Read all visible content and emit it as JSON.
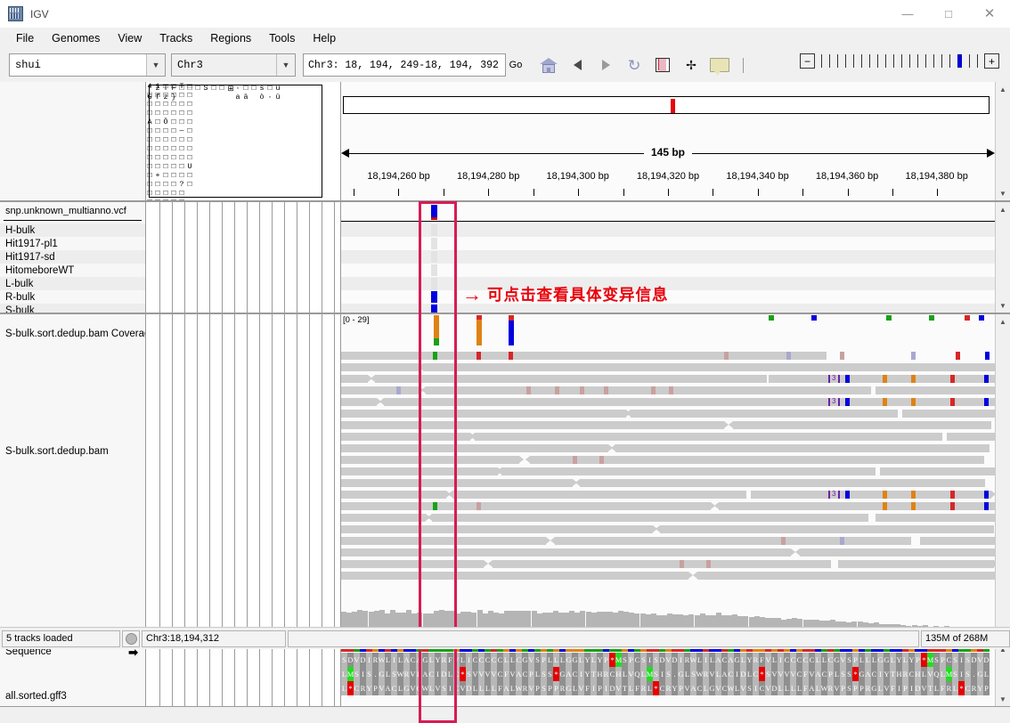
{
  "window": {
    "title": "IGV",
    "logo_icon": "igv-logo-icon",
    "minimize": "—",
    "maximize": "□",
    "close": "✕"
  },
  "menu": {
    "items": [
      "File",
      "Genomes",
      "View",
      "Tracks",
      "Regions",
      "Tools",
      "Help"
    ]
  },
  "toolbar": {
    "genome_value": "shui",
    "genome_placeholder": "Genome",
    "chromosome_value": "Chr3",
    "locus_value": "Chr3: 18, 194, 249-18, 194, 392",
    "go_label": "Go",
    "home_icon": "home-icon",
    "back_icon": "back-arrow-icon",
    "forward_icon": "forward-arrow-icon",
    "refresh_icon": "refresh-icon",
    "region_icon": "region-navigator-icon",
    "fit_icon": "fit-to-window-icon",
    "popup_icon": "popup-behavior-icon",
    "zoom_out_label": "−",
    "zoom_in_label": "+",
    "zoom_ticks": 20,
    "zoom_current_tick": 17
  },
  "ruler": {
    "ideogram_label_column": "4□□□A□□□□□□+□□□□",
    "span_label": "145 bp",
    "ticks": [
      {
        "label": "18,194,260 bp",
        "pos_pct": 8.8
      },
      {
        "label": "18,194,280 bp",
        "pos_pct": 22.5
      },
      {
        "label": "18,194,300 bp",
        "pos_pct": 36.2
      },
      {
        "label": "18,194,320 bp",
        "pos_pct": 50.0
      },
      {
        "label": "18,194,340 bp",
        "pos_pct": 63.7
      },
      {
        "label": "18,194,360 bp",
        "pos_pct": 77.4
      },
      {
        "label": "18,194,380 bp",
        "pos_pct": 91.1
      }
    ]
  },
  "vcf_track": {
    "title": "snp.unknown_multianno.vcf",
    "samples": [
      {
        "name": "H-bulk",
        "genotype": "ref"
      },
      {
        "name": "Hit1917-pl1",
        "genotype": "ref"
      },
      {
        "name": "Hit1917-sd",
        "genotype": "ref"
      },
      {
        "name": "HitomeboreWT",
        "genotype": "ref"
      },
      {
        "name": "L-bulk",
        "genotype": "ref"
      },
      {
        "name": "R-bulk",
        "genotype": "hom"
      },
      {
        "name": "S-bulk",
        "genotype": "hom"
      }
    ],
    "allele_color": "#0000dd",
    "variant_x_pct": 12.6
  },
  "annotation": {
    "arrow": "→",
    "text": "可点击查看具体变异信息",
    "color": "#e8000a",
    "highlight_color": "#d81b55"
  },
  "alignment_track": {
    "coverage_name": "S-bulk.sort.dedup.bam Coverage",
    "coverage_range_label": "[0 - 29]",
    "alignment_name": "S-bulk.sort.dedup.bam",
    "insertion_label": "3"
  },
  "sequence_track": {
    "name": "Sequence",
    "strand_arrow": "➡",
    "gff_name": "all.sorted.gff3",
    "frames": [
      "SDVDIRWLILACAGLYRFVLICCCCCLLCGVSPLLLGGLYLYP*MSPCSI",
      "LMSIS.GLSWRVLACIDLC*SVVVVCFVACPLSS*GACIYTHRCHLVQ",
      "L*CRYPVACLGVCWLVSICVDLLLLFALWRVPSPPRGLVFIPIDVTLFR"
    ]
  },
  "status_bar": {
    "tracks_loaded": "5 tracks loaded",
    "locus": "Chr3:18,194,312",
    "message": "",
    "memory": "135M of 268M"
  }
}
